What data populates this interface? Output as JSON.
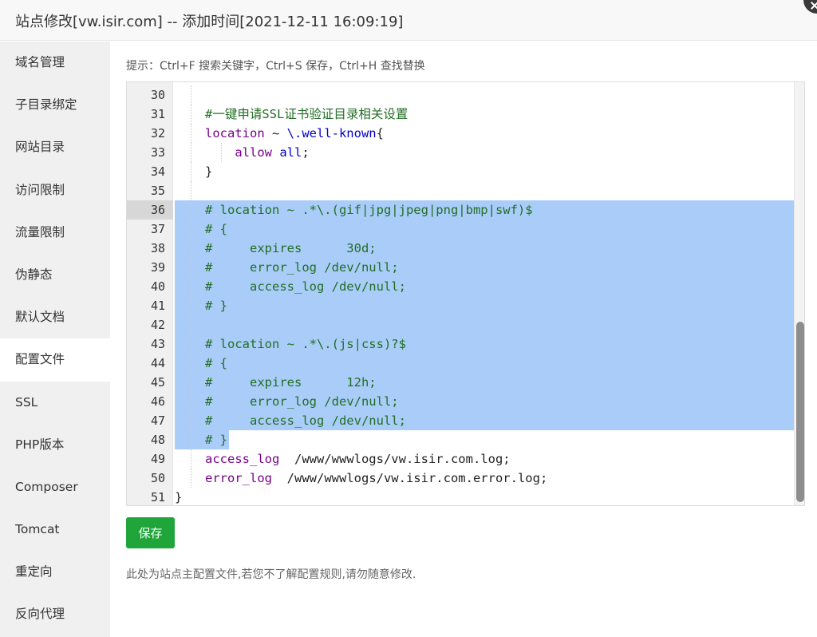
{
  "window": {
    "title": "站点修改[vw.isir.com] -- 添加时间[2021-12-11 16:09:19]"
  },
  "sidebar": {
    "items": [
      {
        "label": "域名管理"
      },
      {
        "label": "子目录绑定"
      },
      {
        "label": "网站目录"
      },
      {
        "label": "访问限制"
      },
      {
        "label": "流量限制"
      },
      {
        "label": "伪静态"
      },
      {
        "label": "默认文档"
      },
      {
        "label": "配置文件",
        "active": true
      },
      {
        "label": "SSL"
      },
      {
        "label": "PHP版本"
      },
      {
        "label": "Composer"
      },
      {
        "label": "Tomcat"
      },
      {
        "label": "重定向"
      },
      {
        "label": "反向代理"
      }
    ]
  },
  "main": {
    "tip": "提示：Ctrl+F 搜索关键字，Ctrl+S 保存，Ctrl+H 查找替换",
    "save_label": "保存",
    "note": "此处为站点主配置文件,若您不了解配置规则,请勿随意修改."
  },
  "editor": {
    "lines": [
      {
        "n": "30",
        "text": ""
      },
      {
        "n": "31",
        "text": "#一键申请SSL证书验证目录相关设置"
      },
      {
        "n": "32",
        "text": "location ~ \\.well-known{"
      },
      {
        "n": "33",
        "text": "    allow all;"
      },
      {
        "n": "34",
        "text": "}"
      },
      {
        "n": "35",
        "text": ""
      },
      {
        "n": "36",
        "text": "# location ~ .*\\.(gif|jpg|jpeg|png|bmp|swf)$"
      },
      {
        "n": "37",
        "text": "# {"
      },
      {
        "n": "38",
        "text": "#     expires      30d;"
      },
      {
        "n": "39",
        "text": "#     error_log /dev/null;"
      },
      {
        "n": "40",
        "text": "#     access_log /dev/null;"
      },
      {
        "n": "41",
        "text": "# }"
      },
      {
        "n": "42",
        "text": ""
      },
      {
        "n": "43",
        "text": "# location ~ .*\\.(js|css)?$"
      },
      {
        "n": "44",
        "text": "# {"
      },
      {
        "n": "45",
        "text": "#     expires      12h;"
      },
      {
        "n": "46",
        "text": "#     error_log /dev/null;"
      },
      {
        "n": "47",
        "text": "#     access_log /dev/null;"
      },
      {
        "n": "48",
        "text": "# }"
      },
      {
        "n": "49",
        "text": "access_log  /www/wwwlogs/vw.isir.com.log;"
      },
      {
        "n": "50",
        "text": "error_log  /www/wwwlogs/vw.isir.com.error.log;"
      },
      {
        "n": "51",
        "text": "}"
      }
    ]
  },
  "colors": {
    "accent": "#20a53a",
    "selection": "#a9ccf8",
    "comment": "#236e25",
    "keyword": "#770088"
  }
}
